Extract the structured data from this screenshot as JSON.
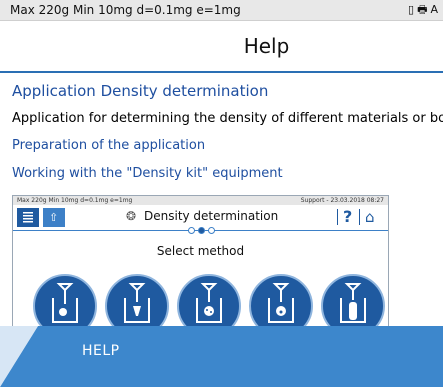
{
  "status_bar": {
    "specs": "Max 220g  Min 10mg  d=0.1mg  e=1mg",
    "battery_icon": "battery-icon",
    "printer_icon": "printer-icon",
    "trailing": "A"
  },
  "header": {
    "title": "Help"
  },
  "content": {
    "heading": "Application Density determination",
    "description": "Application for determining the density of different materials or bo",
    "links": [
      "Preparation of the application",
      "Working with the \"Density kit\" equipment"
    ]
  },
  "screenshot": {
    "status_left": "Max 220g  Min 10mg  d=0.1mg  e=1mg",
    "status_right": "Support  -  23.03.2018 08:27",
    "title": "Density determination",
    "help_glyph": "?",
    "prompt": "Select method",
    "method_count": 5
  },
  "footer": {
    "label": "HELP"
  },
  "colors": {
    "accent": "#1f5aa0",
    "link": "#1f4fa0",
    "footer_band": "#3d87cc",
    "footer_light": "#d7e6f5"
  }
}
